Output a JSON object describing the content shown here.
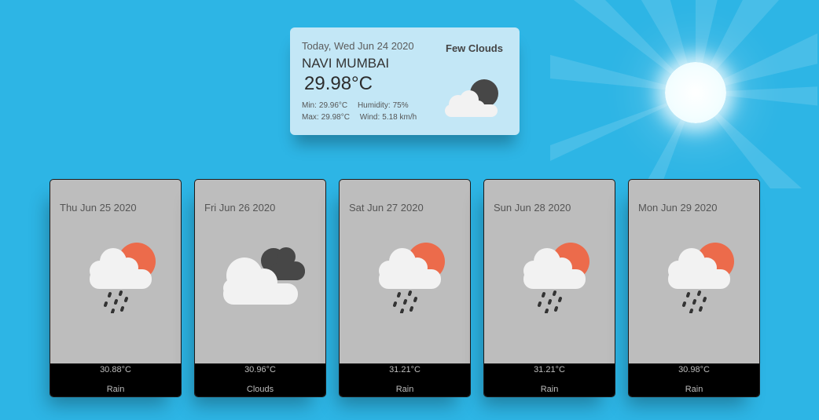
{
  "today": {
    "date": "Today, Wed Jun 24 2020",
    "city": "NAVI MUMBAI",
    "temp": "29.98°C",
    "condition": "Few Clouds",
    "min_label": "Min:",
    "min_value": "29.96°C",
    "max_label": "Max:",
    "max_value": "29.98°C",
    "humidity_label": "Humidity:",
    "humidity_value": "75%",
    "wind_label": "Wind:",
    "wind_value": "5.18 km/h",
    "icon": "few-clouds-night-icon"
  },
  "forecast": [
    {
      "date": "Thu Jun 25 2020",
      "temp": "30.88°C",
      "condition": "Rain",
      "icon": "rain-sun-icon"
    },
    {
      "date": "Fri Jun 26 2020",
      "temp": "30.96°C",
      "condition": "Clouds",
      "icon": "clouds-icon"
    },
    {
      "date": "Sat Jun 27 2020",
      "temp": "31.21°C",
      "condition": "Rain",
      "icon": "rain-sun-icon"
    },
    {
      "date": "Sun Jun 28 2020",
      "temp": "31.21°C",
      "condition": "Rain",
      "icon": "rain-sun-icon"
    },
    {
      "date": "Mon Jun 29 2020",
      "temp": "30.98°C",
      "condition": "Rain",
      "icon": "rain-sun-icon"
    }
  ],
  "colors": {
    "background": "#2db5e5",
    "today_card": "#c3e7f6",
    "forecast_card": "#bdbdbd",
    "forecast_footer": "#000000",
    "sun_orange": "#ec6b4b",
    "dark_cloud": "#474747",
    "light_cloud": "#f2f2f2"
  }
}
